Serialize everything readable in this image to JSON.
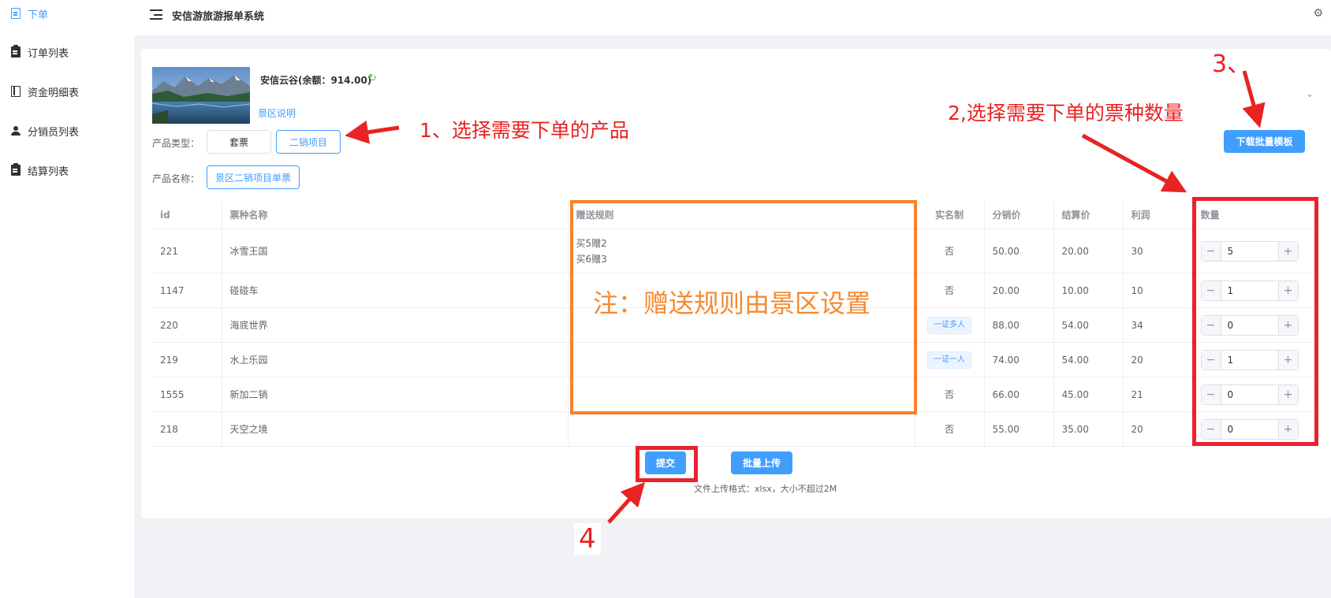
{
  "sidebar": {
    "items": [
      {
        "label": "下单",
        "icon": "document-icon",
        "active": true
      },
      {
        "label": "订单列表",
        "icon": "clipboard-icon"
      },
      {
        "label": "资金明细表",
        "icon": "book-icon"
      },
      {
        "label": "分销员列表",
        "icon": "user-icon"
      },
      {
        "label": "结算列表",
        "icon": "clipboard-icon"
      }
    ]
  },
  "header": {
    "title": "安信游旅游报单系统",
    "settings_icon": "⚙"
  },
  "product": {
    "name": "安信云谷(余额：914.00)",
    "refresh_icon": "↻",
    "intro_link": "景区说明",
    "type_label": "产品类型：",
    "types": [
      "套票",
      "二销项目"
    ],
    "selected_type": "二销项目",
    "name_label": "产品名称：",
    "selected_name": "景区二销项目单票",
    "chevron": "⌄"
  },
  "download_template_button": "下载批量模板",
  "table": {
    "headers": [
      "id",
      "票种名称",
      "赠送规则",
      "实名制",
      "分销价",
      "结算价",
      "利润",
      "数量"
    ],
    "rows": [
      {
        "id": "221",
        "name": "冰雪王国",
        "gift": [
          "买5赠2",
          "买6赠3"
        ],
        "realname": "否",
        "realname_tag": false,
        "dist_price": "50.00",
        "settle_price": "20.00",
        "profit": "30",
        "qty": "5"
      },
      {
        "id": "1147",
        "name": "碰碰车",
        "gift": [],
        "realname": "否",
        "realname_tag": false,
        "dist_price": "20.00",
        "settle_price": "10.00",
        "profit": "10",
        "qty": "1"
      },
      {
        "id": "220",
        "name": "海底世界",
        "gift": [],
        "realname": "一证多人",
        "realname_tag": true,
        "dist_price": "88.00",
        "settle_price": "54.00",
        "profit": "34",
        "qty": "0"
      },
      {
        "id": "219",
        "name": "水上乐园",
        "gift": [],
        "realname": "一证一人",
        "realname_tag": true,
        "dist_price": "74.00",
        "settle_price": "54.00",
        "profit": "20",
        "qty": "1"
      },
      {
        "id": "1555",
        "name": "新加二销",
        "gift": [],
        "realname": "否",
        "realname_tag": false,
        "dist_price": "66.00",
        "settle_price": "45.00",
        "profit": "21",
        "qty": "0"
      },
      {
        "id": "218",
        "name": "天空之境",
        "gift": [],
        "realname": "否",
        "realname_tag": false,
        "dist_price": "55.00",
        "settle_price": "35.00",
        "profit": "20",
        "qty": "0"
      }
    ]
  },
  "actions": {
    "submit": "提交",
    "batch_upload": "批量上传",
    "format_hint": "文件上传格式：xlsx，大小不超过2M"
  },
  "annotations": {
    "step1": "1、选择需要下单的产品",
    "step2": "2,选择需要下单的票种数量",
    "step3": "3、",
    "step4": "4",
    "note": "注：赠送规则由景区设置",
    "annotation_color": "#e82323",
    "note_color": "#f58a2f"
  },
  "colors": {
    "primary": "#409eff",
    "gift_rule": "#f56c6c",
    "refresh": "#67c23a"
  }
}
